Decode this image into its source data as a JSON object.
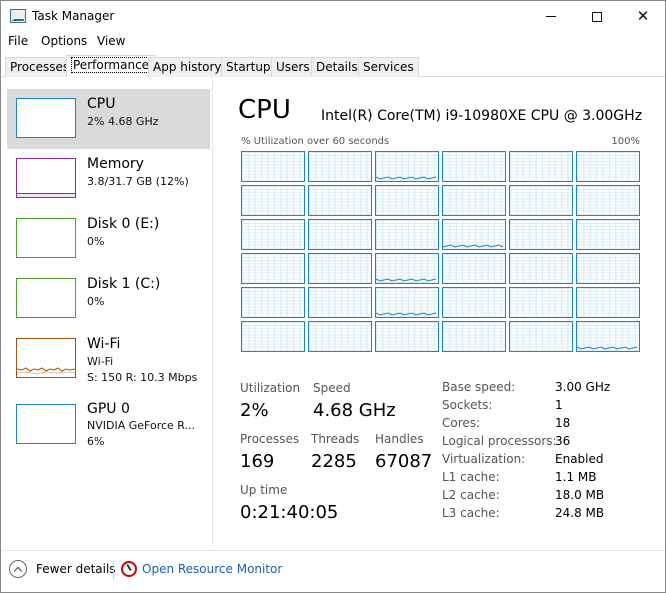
{
  "window": {
    "title": "Task Manager"
  },
  "menu": {
    "file": "File",
    "options": "Options",
    "view": "View"
  },
  "tabs": [
    "Processes",
    "Performance",
    "App history",
    "Startup",
    "Users",
    "Details",
    "Services"
  ],
  "active_tab": "Performance",
  "resources": [
    {
      "title": "CPU",
      "line1": "2%  4.68 GHz",
      "color": "#1a87c5",
      "selected": true
    },
    {
      "title": "Memory",
      "line1": "3.8/31.7 GB (12%)",
      "color": "#8b2fa6"
    },
    {
      "title": "Disk 0 (E:)",
      "line1": "0%",
      "color": "#4aa02c"
    },
    {
      "title": "Disk 1 (C:)",
      "line1": "0%",
      "color": "#4aa02c"
    },
    {
      "title": "Wi-Fi",
      "line1": "Wi-Fi",
      "line2": "S: 150  R: 10.3 Mbps",
      "color": "#a7520c"
    },
    {
      "title": "GPU 0",
      "line1": "NVIDIA GeForce R...",
      "line2": "6%",
      "color": "#1a87c5"
    }
  ],
  "cpu": {
    "heading": "CPU",
    "name": "Intel(R) Core(TM) i9-10980XE CPU @ 3.00GHz",
    "util_label": "% Utilization over 60 seconds",
    "util_max": "100%"
  },
  "stats": {
    "utilization_label": "Utilization",
    "utilization": "2%",
    "speed_label": "Speed",
    "speed": "4.68 GHz",
    "processes_label": "Processes",
    "processes": "169",
    "threads_label": "Threads",
    "threads": "2285",
    "handles_label": "Handles",
    "handles": "67087",
    "uptime_label": "Up time",
    "uptime": "0:21:40:05"
  },
  "specs": [
    {
      "label": "Base speed:",
      "value": "3.00 GHz"
    },
    {
      "label": "Sockets:",
      "value": "1"
    },
    {
      "label": "Cores:",
      "value": "18"
    },
    {
      "label": "Logical processors:",
      "value": "36"
    },
    {
      "label": "Virtualization:",
      "value": "Enabled"
    },
    {
      "label": "L1 cache:",
      "value": "1.1 MB"
    },
    {
      "label": "L2 cache:",
      "value": "18.0 MB"
    },
    {
      "label": "L3 cache:",
      "value": "24.8 MB"
    }
  ],
  "footer": {
    "fewer_details": "Fewer details",
    "open_resource_monitor": "Open Resource Monitor"
  }
}
